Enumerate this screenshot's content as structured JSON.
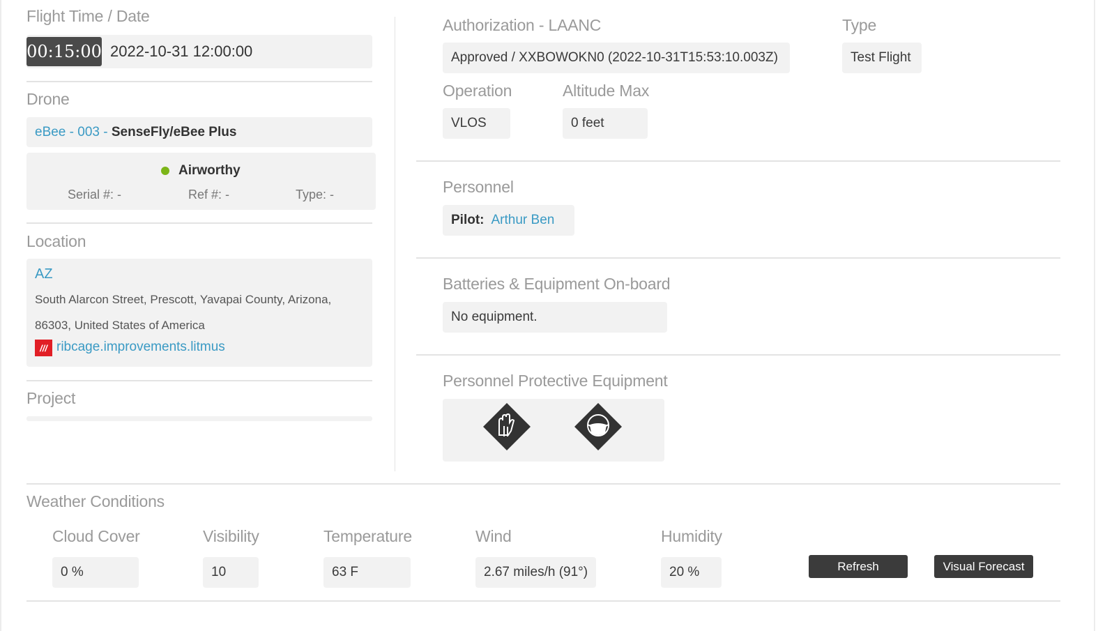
{
  "flight": {
    "title": "Flight Time / Date",
    "duration": "00:15:00",
    "datetime": "2022-10-31 12:00:00"
  },
  "drone": {
    "title": "Drone",
    "link": "eBee - 003",
    "separator": " - ",
    "model": "SenseFly/eBee Plus",
    "status": "Airworthy",
    "status_color": "#7cb518",
    "serial": "Serial #: -",
    "ref": "Ref #: -",
    "type": "Type: -"
  },
  "location": {
    "title": "Location",
    "name": "AZ",
    "address_line1": "South Alarcon Street, Prescott, Yavapai County, Arizona,",
    "address_line2": "86303, United States of America",
    "w3w_icon": "///",
    "w3w": "ribcage.improvements.litmus"
  },
  "project": {
    "title": "Project"
  },
  "authorization": {
    "title": "Authorization - LAANC",
    "value": "Approved / XXBOWOKN0 (2022-10-31T15:53:10.003Z)"
  },
  "type": {
    "title": "Type",
    "value": "Test Flight"
  },
  "operation": {
    "title": "Operation",
    "value": "VLOS"
  },
  "altitude": {
    "title": "Altitude Max",
    "value": "0 feet"
  },
  "personnel": {
    "title": "Personnel",
    "pilot_label": "Pilot:",
    "pilot_name": "Arthur Ben"
  },
  "batteries": {
    "title": "Batteries & Equipment On-board",
    "value": "No equipment."
  },
  "ppe": {
    "title": "Personnel Protective Equipment",
    "icons": [
      "gloves-icon",
      "face-mask-icon"
    ]
  },
  "weather": {
    "title": "Weather Conditions",
    "cloud_label": "Cloud Cover",
    "cloud_value": "0 %",
    "visibility_label": "Visibility",
    "visibility_value": "10",
    "temperature_label": "Temperature",
    "temperature_value": "63 F",
    "wind_label": "Wind",
    "wind_value": "2.67 miles/h (91°)",
    "humidity_label": "Humidity",
    "humidity_value": "20 %",
    "refresh_label": "Refresh",
    "forecast_label": "Visual Forecast"
  },
  "colors": {
    "accent_link": "#3a9ac4",
    "button_bg": "#3b3b3b",
    "w3w_red": "#e11f26"
  }
}
